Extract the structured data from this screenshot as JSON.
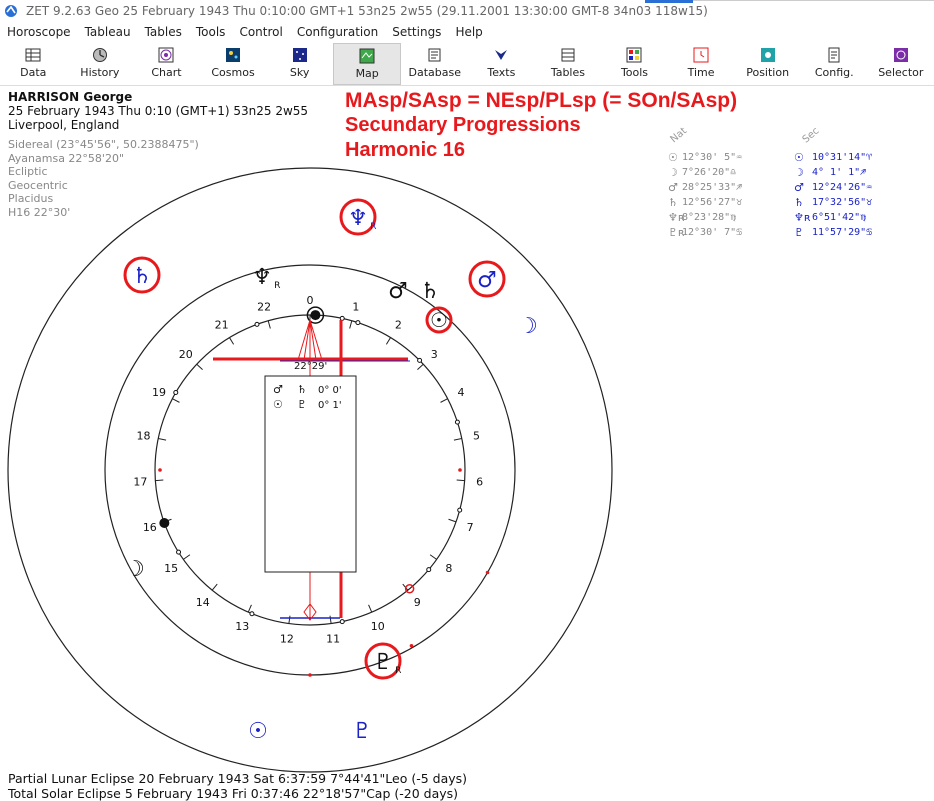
{
  "titlebar": {
    "text": "ZET 9.2.63 Geo   25 February 1943  Thu   0:10:00 GMT+1 53n25  2w55   (29.11.2001  13:30:00 GMT-8 34n03 118w15)"
  },
  "menu": [
    "Horoscope",
    "Tableau",
    "Tables",
    "Tools",
    "Control",
    "Configuration",
    "Settings",
    "Help"
  ],
  "toolbar": [
    {
      "label": "Data",
      "icon": "data-icon"
    },
    {
      "label": "History",
      "icon": "history-icon"
    },
    {
      "label": "Chart",
      "icon": "chart-icon"
    },
    {
      "label": "Cosmos",
      "icon": "cosmos-icon"
    },
    {
      "label": "Sky",
      "icon": "sky-icon"
    },
    {
      "label": "Map",
      "icon": "map-icon",
      "active": true
    },
    {
      "label": "Database",
      "icon": "database-icon"
    },
    {
      "label": "Texts",
      "icon": "texts-icon"
    },
    {
      "label": "Tables",
      "icon": "tables-icon"
    },
    {
      "label": "Tools",
      "icon": "tools-icon"
    },
    {
      "label": "Time",
      "icon": "time-icon"
    },
    {
      "label": "Position",
      "icon": "position-icon"
    },
    {
      "label": "Config.",
      "icon": "config-icon"
    },
    {
      "label": "Selector",
      "icon": "selector-icon"
    }
  ],
  "person": {
    "name": "HARRISON George",
    "datetime": "25 February 1943  Thu    0:10 (GMT+1) 53n25  2w55",
    "place": "Liverpool, England"
  },
  "settings": [
    "Sidereal (23°45'56\", 50.2388475\")",
    "Ayanamsa 22°58'20\"",
    "Ecliptic",
    "Geocentric",
    "Placidus",
    "H16  22°30'"
  ],
  "heading": {
    "line1": "MAsp/SAsp = NEsp/PLsp (= SOn/SAsp)",
    "line2": "Secundary Progressions",
    "line3": "Harmonic 16"
  },
  "positions": {
    "col1_header": "Nat",
    "col2_header": "Sec",
    "rows": [
      {
        "g1": "☉",
        "v1": "12°30' 5\"♒",
        "g2": "☉",
        "v2": "10°31'14\"♈"
      },
      {
        "g1": "☽",
        "v1": " 7°26'20\"♎",
        "g2": "☽",
        "v2": " 4° 1' 1\"♐"
      },
      {
        "g1": "♂",
        "v1": "28°25'33\"♐",
        "g2": "♂",
        "v2": "12°24'26\"♒"
      },
      {
        "g1": "♄",
        "v1": "12°56'27\"♉",
        "g2": "♄",
        "v2": "17°32'56\"♉"
      },
      {
        "g1": "♆ʀ",
        "v1": " 8°23'28\"♍",
        "g2": "♆ʀ",
        "v2": " 6°51'42\"♍"
      },
      {
        "g1": "♇ʀ",
        "v1": "12°30' 7\"♋",
        "g2": "♇",
        "v2": "11°57'29\"♋"
      }
    ]
  },
  "chart": {
    "dial_labels": [
      "0",
      "1",
      "2",
      "3",
      "4",
      "5",
      "6",
      "7",
      "8",
      "9",
      "10",
      "11",
      "12",
      "13",
      "14",
      "15",
      "16",
      "17",
      "18",
      "19",
      "20",
      "21",
      "22"
    ],
    "axis_label": "22°29'",
    "aspect_box": [
      {
        "g": "♂",
        "rel": "♄",
        "val": "0° 0'"
      },
      {
        "g": "☉",
        "rel": "♇",
        "val": "0° 1'"
      }
    ],
    "inner_planets": [
      {
        "glyph": "♆",
        "sub": "R",
        "color": "#111"
      },
      {
        "glyph": "♂",
        "color": "#111"
      },
      {
        "glyph": "♄",
        "color": "#111"
      },
      {
        "glyph": "☽",
        "color": "#111"
      }
    ],
    "outer_planets": [
      {
        "glyph": "♆",
        "sub": "R",
        "color": "#1a22c8",
        "circled": true
      },
      {
        "glyph": "♄",
        "color": "#1a22c8",
        "circled": true
      },
      {
        "glyph": "♂",
        "color": "#1a22c8",
        "circled": true
      },
      {
        "glyph": "☽",
        "color": "#1a22c8"
      },
      {
        "glyph": "♇",
        "sub": "R",
        "color": "#111",
        "circled": true
      },
      {
        "glyph": "☉",
        "color": "#1a22c8"
      },
      {
        "glyph": "♇",
        "color": "#1a22c8"
      }
    ],
    "sun_marker": {
      "glyph": "☉",
      "color": "#111"
    },
    "colors": {
      "highlight": "#e8191c",
      "secondary": "#1a22c8",
      "natal": "#111111"
    }
  },
  "footer": {
    "line1": "Partial Lunar Eclipse 20 February 1943 Sat  6:37:59  7°44'41\"Leo (-5 days)",
    "line2": "Total Solar Eclipse 5 February 1943 Fri  0:37:46 22°18'57\"Cap (-20 days)"
  }
}
